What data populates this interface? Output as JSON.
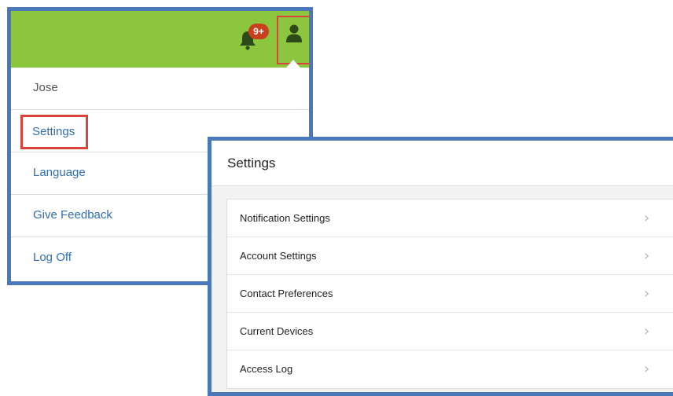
{
  "colors": {
    "topbar": "#8cc63f",
    "frame": "#4a78b9",
    "highlight": "#d9433b",
    "link": "#2f6fb0",
    "badge": "#c8401e"
  },
  "notifications": {
    "badge_count": "9+",
    "icon": "bell-icon"
  },
  "user_button": {
    "icon": "user-icon"
  },
  "user_menu": {
    "name": "Jose",
    "items": [
      {
        "label": "Settings",
        "highlighted": true
      },
      {
        "label": "Language"
      },
      {
        "label": "Give Feedback"
      },
      {
        "label": "Log Off"
      }
    ]
  },
  "settings": {
    "title": "Settings",
    "items": [
      {
        "label": "Notification Settings",
        "icon": "chevron-right-icon"
      },
      {
        "label": "Account Settings",
        "icon": "chevron-right-icon"
      },
      {
        "label": "Contact Preferences",
        "icon": "chevron-right-icon"
      },
      {
        "label": "Current Devices",
        "icon": "chevron-right-icon"
      },
      {
        "label": "Access Log",
        "icon": "chevron-right-icon"
      }
    ]
  }
}
